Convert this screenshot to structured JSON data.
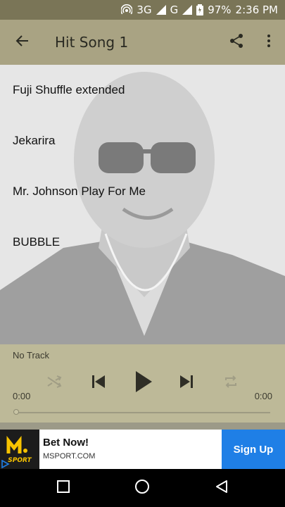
{
  "status_bar": {
    "network": "3G",
    "network2": "G",
    "battery": "97%",
    "time": "2:36 PM"
  },
  "app_bar": {
    "title": "Hit Song 1",
    "icons": [
      "back-arrow-icon",
      "share-icon",
      "more-vert-icon"
    ]
  },
  "songs": [
    {
      "title": "Fuji Shuffle extended"
    },
    {
      "title": "Jekarira"
    },
    {
      "title": "Mr. Johnson Play For Me"
    },
    {
      "title": "BUBBLE"
    }
  ],
  "player": {
    "track": "No Track",
    "elapsed": "0:00",
    "duration": "0:00",
    "progress": 0,
    "controls": [
      "shuffle-icon",
      "skip-previous-icon",
      "play-icon",
      "skip-next-icon",
      "repeat-icon"
    ]
  },
  "ad": {
    "brand_logo_text": "SPORT",
    "title": "Bet Now!",
    "domain": "MSPORT.COM",
    "cta": "Sign Up",
    "cta_color": "#1f7fe6"
  },
  "nav_bar": {
    "icons": [
      "recents-square-icon",
      "home-circle-icon",
      "back-triangle-icon"
    ]
  },
  "colors": {
    "status_bar": "#7a7557",
    "app_bar": "#a9a383",
    "player": "#bdb998"
  }
}
